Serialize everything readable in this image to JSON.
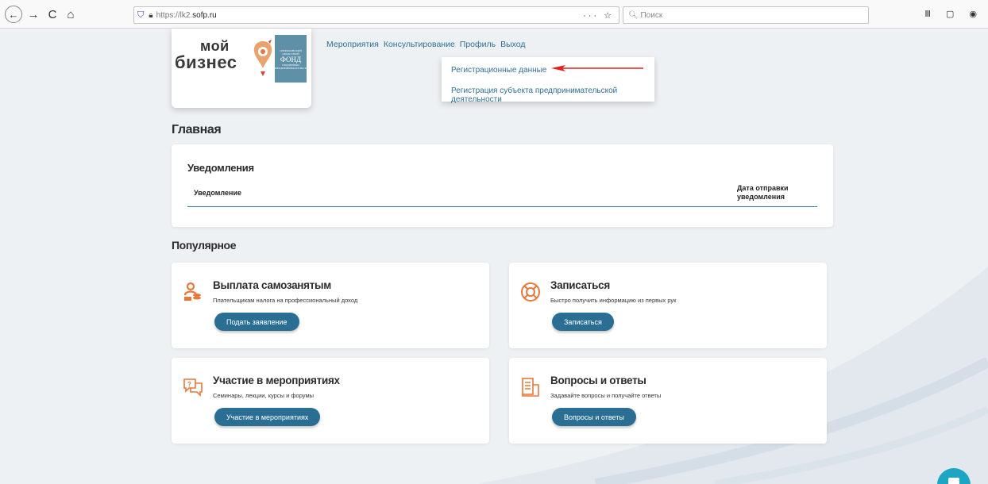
{
  "browser": {
    "back": "←",
    "forward": "→",
    "reload": "C",
    "home": "⌂",
    "url_prefix": "https://lk2.",
    "url_host": "sofp.ru",
    "url_actions": "··· ☆",
    "search_placeholder": "Поиск",
    "toolbar_icons": "Ⅲ ▢ ◉"
  },
  "logo": {
    "line1": "мой",
    "line2": "бизнес",
    "fund_top": "СВЕРДЛОВСКИЙ ОБЛАСТНОЙ",
    "fund_main": "ФОНД",
    "fund_bottom": "ПОДДЕРЖКИ ПРЕДПРИНИМАТЕЛЬСТВА"
  },
  "nav": {
    "items": [
      "Мероприятия",
      "Консультирование",
      "Профиль",
      "Выход"
    ]
  },
  "profile_menu": {
    "items": [
      "Регистрационные данные",
      "Регистрация субъекта предпринимательской деятельности"
    ]
  },
  "main": {
    "heading": "Главная",
    "notifications": {
      "title": "Уведомления",
      "columns": [
        "Уведомление",
        "Дата отправки уведомления"
      ]
    },
    "popular_heading": "Популярное",
    "cards": [
      {
        "title": "Выплата самозанятым",
        "subtitle": "Плательщикам налога на профессиональный доход",
        "button": "Подать заявление",
        "icon": "person-coins-icon"
      },
      {
        "title": "Записаться",
        "subtitle": "Быстро получить информацию из первых рук",
        "button": "Записаться",
        "icon": "lifebuoy-icon"
      },
      {
        "title": "Участие в мероприятиях",
        "subtitle": "Семинары, лекции, курсы и форумы",
        "button": "Участие в мероприятиях",
        "icon": "chat-question-icon"
      },
      {
        "title": "Вопросы и ответы",
        "subtitle": "Задавайте вопросы и получайте ответы",
        "button": "Вопросы и ответы",
        "icon": "document-list-icon"
      }
    ]
  },
  "colors": {
    "accent": "#2a6f93",
    "icon_orange": "#e9773a",
    "link": "#2f6f97",
    "arrow_red": "#e02020",
    "fab": "#1da5c4"
  }
}
